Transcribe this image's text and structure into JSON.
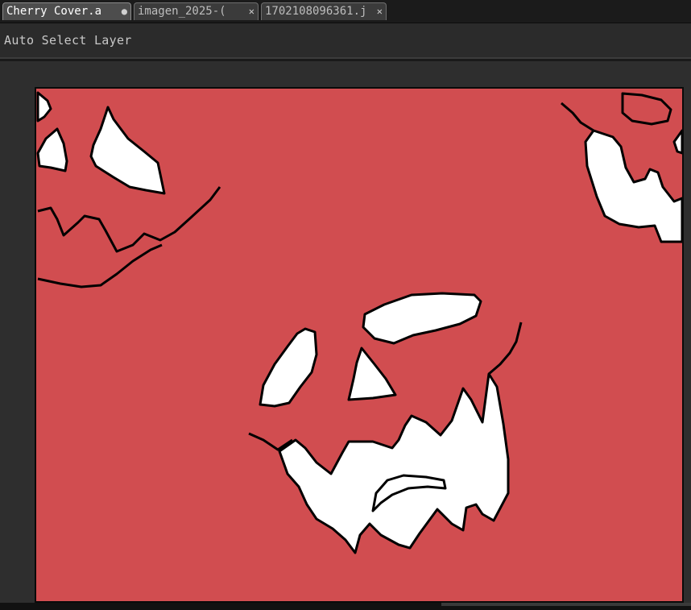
{
  "tabs": [
    {
      "label": "Cherry Cover.a",
      "marker": "●",
      "active": true
    },
    {
      "label": "imagen_2025-(",
      "marker": "✕",
      "active": false
    },
    {
      "label": "1702108096361.j",
      "marker": "✕",
      "active": false
    }
  ],
  "toolbar": {
    "auto_select_label": "Auto Select Layer"
  },
  "icons": {
    "modified": "modified-dot-icon",
    "close": "close-x-icon"
  },
  "colors": {
    "canvas_fill": "#d14d50",
    "ink": "#000000",
    "highlight": "#ffffff"
  }
}
